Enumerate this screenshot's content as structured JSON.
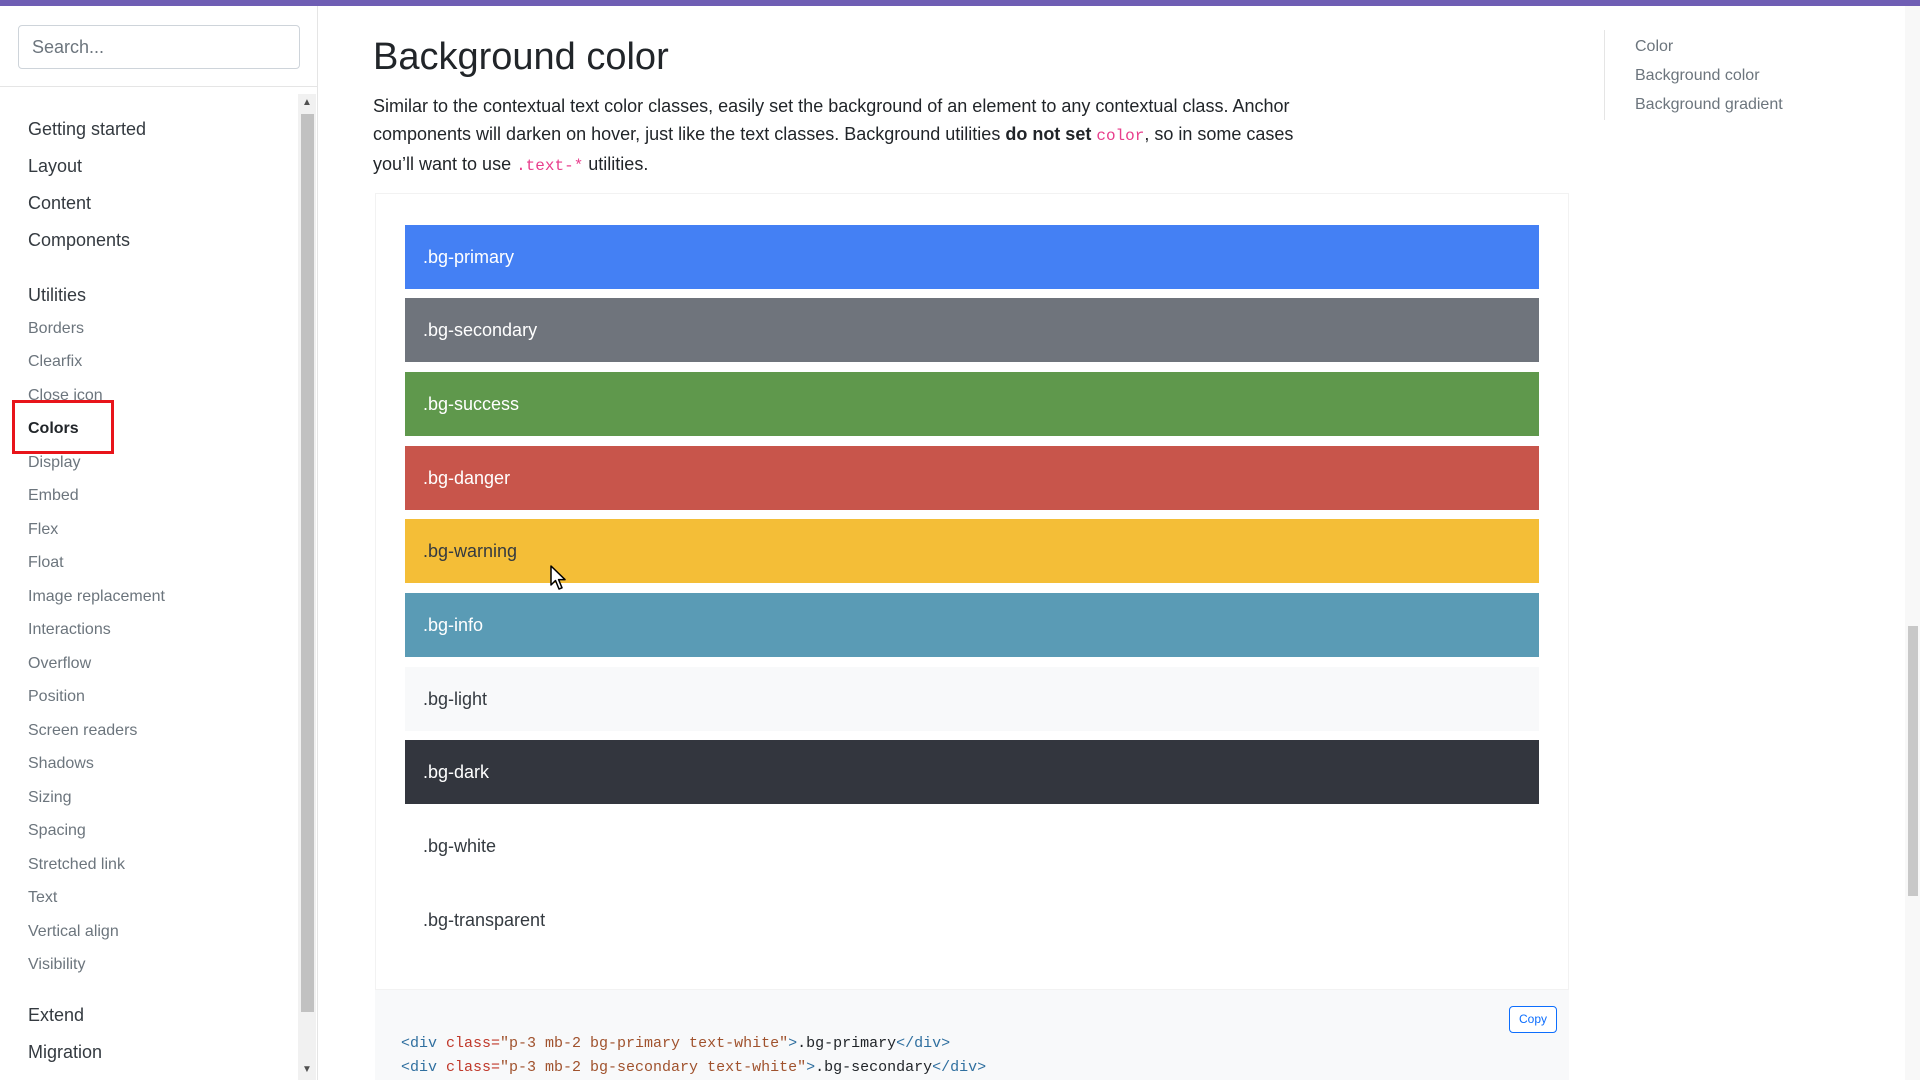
{
  "sidebar": {
    "search_placeholder": "Search...",
    "groups": [
      {
        "label": "Getting started"
      },
      {
        "label": "Layout"
      },
      {
        "label": "Content"
      },
      {
        "label": "Components"
      },
      {
        "label": "Utilities"
      },
      {
        "label": "Extend"
      },
      {
        "label": "Migration"
      }
    ],
    "utilities_items": [
      {
        "label": "Borders"
      },
      {
        "label": "Clearfix"
      },
      {
        "label": "Close icon"
      },
      {
        "label": "Colors",
        "active": true
      },
      {
        "label": "Display"
      },
      {
        "label": "Embed"
      },
      {
        "label": "Flex"
      },
      {
        "label": "Float"
      },
      {
        "label": "Image replacement"
      },
      {
        "label": "Interactions"
      },
      {
        "label": "Overflow"
      },
      {
        "label": "Position"
      },
      {
        "label": "Screen readers"
      },
      {
        "label": "Shadows"
      },
      {
        "label": "Sizing"
      },
      {
        "label": "Spacing"
      },
      {
        "label": "Stretched link"
      },
      {
        "label": "Text"
      },
      {
        "label": "Vertical align"
      },
      {
        "label": "Visibility"
      }
    ],
    "scroll_up_icon": "triangle-up-icon",
    "scroll_down_icon": "triangle-down-icon"
  },
  "main": {
    "title": "Background color",
    "intro": {
      "part1": "Similar to the contextual text color classes, easily set the background of an element to any contextual class. Anchor components will darken on hover, just like the text classes. Background utilities ",
      "bold": "do not set",
      "space": " ",
      "code1": "color",
      "part2": ", so in some cases you’ll want to use ",
      "code2": ".text-*",
      "part3": " utilities."
    },
    "swatches": [
      {
        "label": ".bg-primary",
        "bg": "#4480f4",
        "fg": "#ffffff"
      },
      {
        "label": ".bg-secondary",
        "bg": "#6f747c",
        "fg": "#ffffff"
      },
      {
        "label": ".bg-success",
        "bg": "#5f984c",
        "fg": "#ffffff"
      },
      {
        "label": ".bg-danger",
        "bg": "#c8554b",
        "fg": "#ffffff"
      },
      {
        "label": ".bg-warning",
        "bg": "#f4be37",
        "fg": "#343a40"
      },
      {
        "label": ".bg-info",
        "bg": "#5a9bb5",
        "fg": "#ffffff"
      },
      {
        "label": ".bg-light",
        "bg": "#f8f9fa",
        "fg": "#343a40"
      },
      {
        "label": ".bg-dark",
        "bg": "#33363e",
        "fg": "#ffffff"
      },
      {
        "label": ".bg-white",
        "bg": "#ffffff",
        "fg": "#343a40"
      },
      {
        "label": ".bg-transparent",
        "bg": "transparent",
        "fg": "#343a40"
      }
    ],
    "code": {
      "copy_label": "Copy",
      "lines": [
        {
          "tag_open": "<div",
          "attr": " class=",
          "value": "\"p-3 mb-2 bg-primary text-white\"",
          "gt": ">",
          "text": ".bg-primary",
          "tag_close": "</div>"
        },
        {
          "tag_open": "<div",
          "attr": " class=",
          "value": "\"p-3 mb-2 bg-secondary text-white\"",
          "gt": ">",
          "text": ".bg-secondary",
          "tag_close": "</div>"
        }
      ]
    }
  },
  "toc": {
    "links": [
      {
        "label": "Color"
      },
      {
        "label": "Background color"
      },
      {
        "label": "Background gradient"
      }
    ]
  },
  "colors": {
    "accent_bar": "#6f5eb4",
    "highlight_box": "#e8141a"
  },
  "cursor_icon": "mouse-pointer-icon"
}
